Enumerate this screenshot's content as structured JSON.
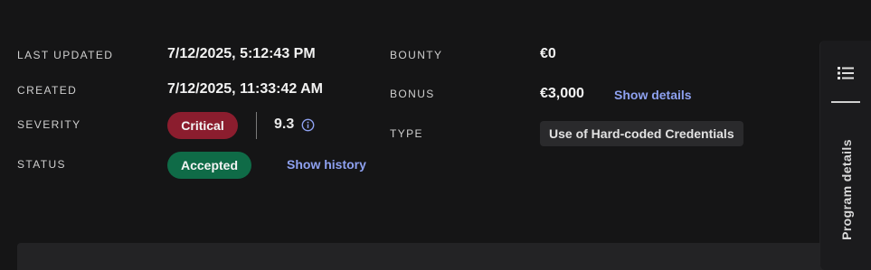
{
  "details": {
    "last_updated": {
      "label": "LAST UPDATED",
      "value": "7/12/2025, 5:12:43 PM"
    },
    "created": {
      "label": "CREATED",
      "value": "7/12/2025, 11:33:42 AM"
    },
    "severity": {
      "label": "SEVERITY",
      "badge": "Critical",
      "score": "9.3",
      "badge_color": "#8b1d2e"
    },
    "status": {
      "label": "STATUS",
      "badge": "Accepted",
      "link": "Show history",
      "badge_color": "#0f6b47"
    },
    "bounty": {
      "label": "BOUNTY",
      "value": "€0"
    },
    "bonus": {
      "label": "BONUS",
      "value": "€3,000",
      "link": "Show details"
    },
    "type": {
      "label": "TYPE",
      "value": "Use of Hard-coded Credentials"
    }
  },
  "side_panel": {
    "list_icon": "list-icon",
    "tab_label": "Program details"
  },
  "colors": {
    "background": "#151516",
    "link": "#8ea1f0"
  }
}
